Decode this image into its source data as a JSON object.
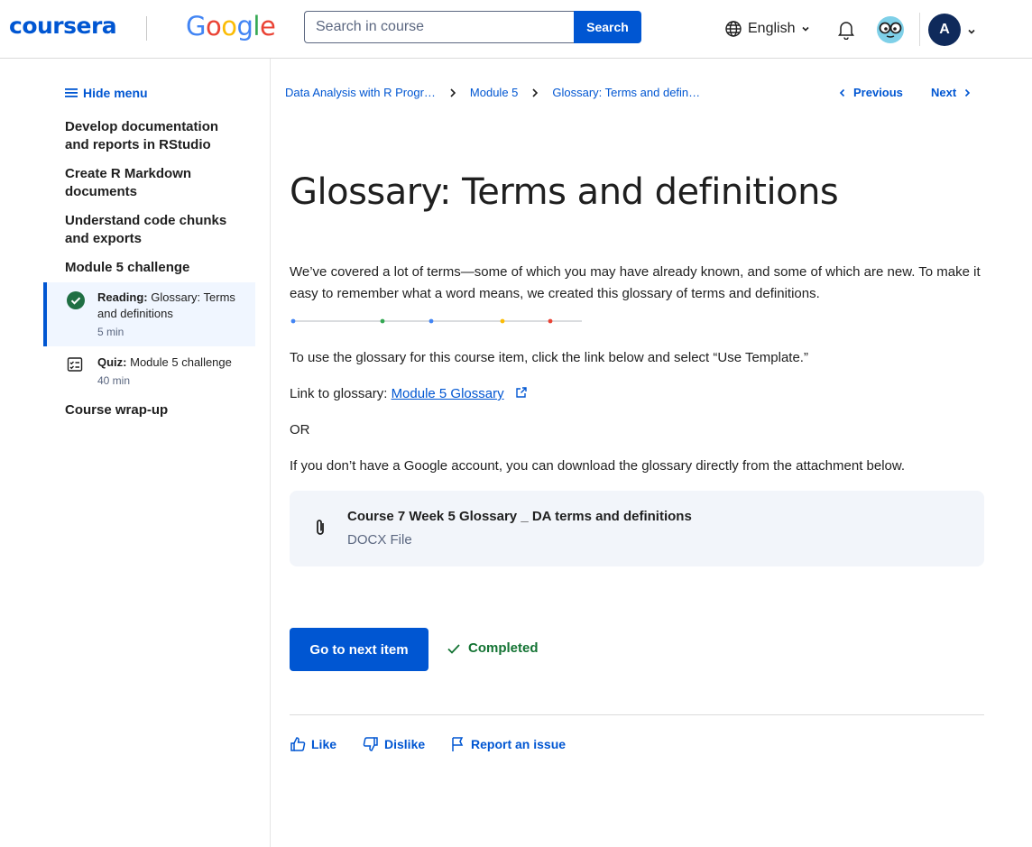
{
  "header": {
    "brand": "coursera",
    "partner": [
      "G",
      "o",
      "o",
      "g",
      "l",
      "e"
    ],
    "search_placeholder": "Search in course",
    "search_button": "Search",
    "language": "English",
    "user_initial": "A"
  },
  "sidebar": {
    "hide_menu": "Hide menu",
    "sections": [
      "Develop documentation and reports in RStudio",
      "Create R Markdown documents",
      "Understand code chunks and exports",
      "Module 5 challenge",
      "Course wrap-up"
    ],
    "items": [
      {
        "type": "Reading:",
        "title": "Glossary: Terms and definitions",
        "duration": "5 min",
        "status": "completed"
      },
      {
        "type": "Quiz:",
        "title": "Module 5 challenge",
        "duration": "40 min",
        "status": "quiz"
      }
    ]
  },
  "breadcrumb": [
    "Data Analysis with R Progr…",
    "Module 5",
    "Glossary: Terms and defin…"
  ],
  "nav": {
    "previous": "Previous",
    "next": "Next"
  },
  "content": {
    "title": "Glossary: Terms and definitions",
    "intro": "We’ve covered a lot of terms—some of which you may have already known, and some of which are new. To make it easy to remember what a word means, we created this glossary of terms and definitions.",
    "instruction": "To use the glossary for this course item, click the link below and select “Use Template.”",
    "link_prefix": "Link to glossary: ",
    "link_text": "Module 5 Glossary",
    "or": "OR",
    "download_text": "If you don’t have a Google account, you can download the glossary directly from the attachment below.",
    "attachment": {
      "name": "Course 7 Week 5 Glossary _ DA terms and definitions",
      "type": "DOCX File"
    },
    "divider_dot_colors": [
      "#4285f4",
      "#34a853",
      "#4285f4",
      "#fbbc05",
      "#ea4335"
    ]
  },
  "actions": {
    "next_item": "Go to next item",
    "completed": "Completed",
    "like": "Like",
    "dislike": "Dislike",
    "report": "Report an issue"
  },
  "colors": {
    "accent": "#0056d2",
    "success": "#137333",
    "completed_badge": "#1f6f43"
  }
}
